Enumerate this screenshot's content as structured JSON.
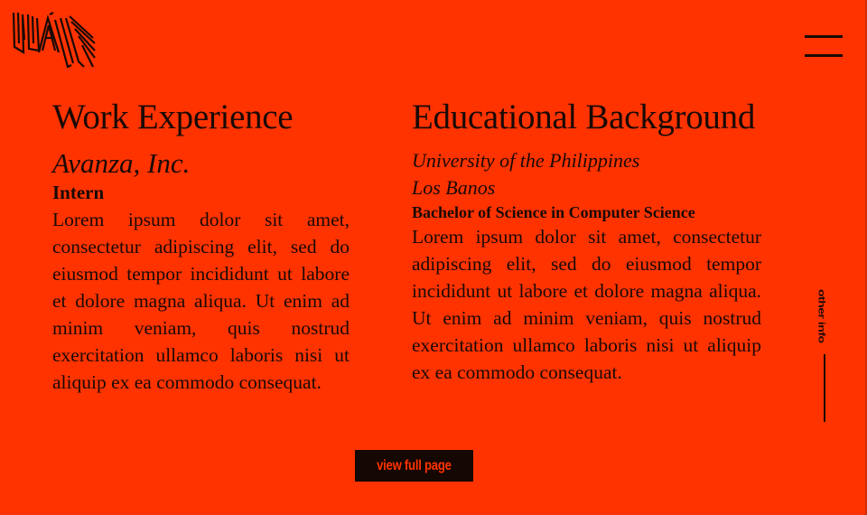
{
  "header": {
    "logo_icon": "wam-logo-icon",
    "menu_icon": "hamburger-menu-icon"
  },
  "work": {
    "title": "Work Experience",
    "company": "Avanza, Inc.",
    "role": "Intern",
    "description": "Lorem ipsum dolor sit amet, consectetur adipiscing elit, sed do eiusmod tempor incididunt ut labore et dolore magna aliqua. Ut enim ad minim veniam, quis nostrud exercitation ullamco laboris nisi ut aliquip ex ea commodo consequat."
  },
  "education": {
    "title": "Educational Background",
    "school_line1": "University of the Philippines",
    "school_line2": "Los Banos",
    "degree": "Bachelor of Science in Computer Science",
    "description": "Lorem ipsum dolor sit amet, consectetur adipiscing elit, sed do eiusmod tempor incididunt ut labore et dolore magna aliqua. Ut enim ad minim veniam, quis nostrud exercitation ullamco laboris nisi ut aliquip ex ea commodo consequat."
  },
  "side_nav": {
    "label": "other info"
  },
  "actions": {
    "view_full_page": "view full page"
  },
  "colors": {
    "background": "#ff3300",
    "text": "#1a0a05",
    "button_background": "#150703",
    "button_text": "#ff3300"
  }
}
